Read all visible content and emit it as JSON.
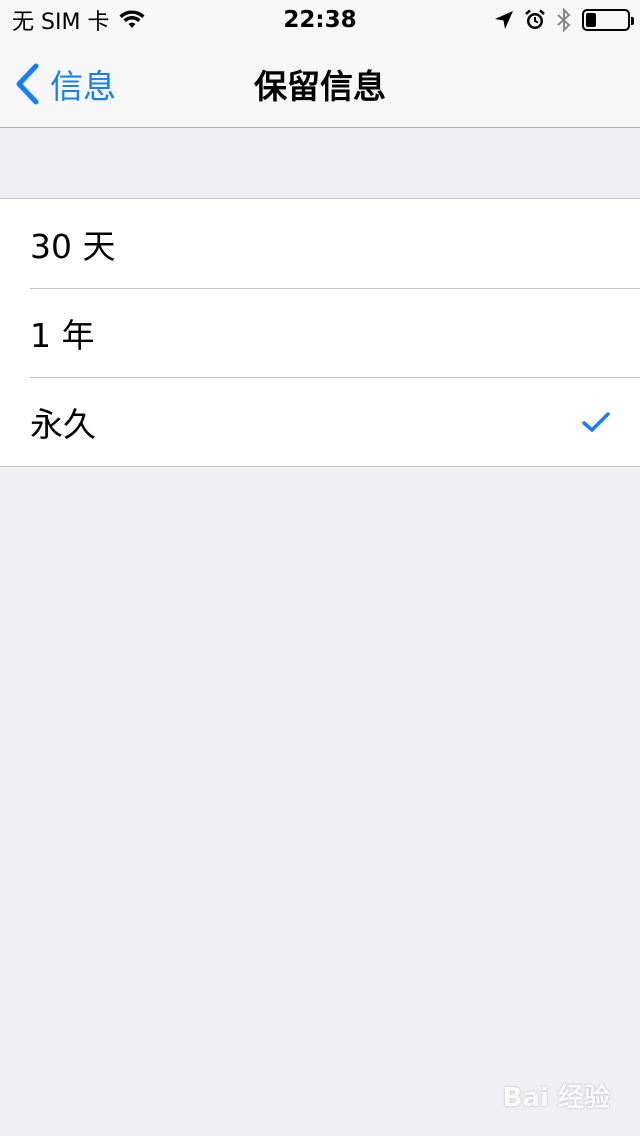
{
  "status_bar": {
    "carrier": "无 SIM 卡",
    "time": "22:38",
    "battery_level": 0.25,
    "icons": [
      "wifi-icon",
      "location-arrow-icon",
      "alarm-icon",
      "bluetooth-icon",
      "battery-icon"
    ]
  },
  "nav": {
    "back_label": "信息",
    "title": "保留信息"
  },
  "options": [
    {
      "label": "30 天",
      "selected": false
    },
    {
      "label": "1 年",
      "selected": false
    },
    {
      "label": "永久",
      "selected": true
    }
  ],
  "colors": {
    "accent": "#147efb",
    "background": "#efeff4",
    "separator": "#c8c7cc"
  },
  "watermark": {
    "text": "Bai 经验"
  }
}
